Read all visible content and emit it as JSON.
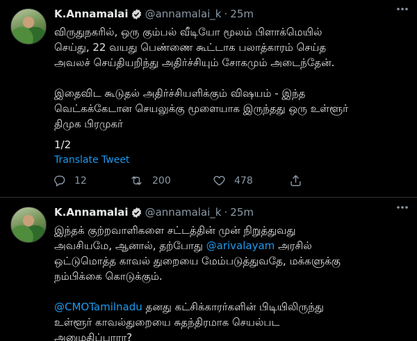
{
  "colors": {
    "background": "#000000",
    "text": "#e1e1e1",
    "secondary": "#8b98a5",
    "link": "#1d9bf0",
    "verified": "#d9d9d9"
  },
  "tweets": [
    {
      "name": "K.Annamalai",
      "handle": "@annamalai_k",
      "dot": "·",
      "time": "25m",
      "verified_icon": "verified-badge-icon",
      "lines": [
        "விருதுநகரில், ஒரு கும்பல் வீடியோ மூலம் பிளாக்மெயில்",
        "செய்து, 22 வயது பெண்ணை  கூட்டாக பலாத்காரம் செய்த",
        "அவலச் செய்தியறிந்து அதிர்ச்சியும் சோகமும் அடைந்தேன்.",
        "இதைவிட கூடுதல் அதிர்ச்சியளிக்கும் விஷயம் - இந்த",
        "வெட்கக்கேடான செயலுக்கு மூளையாக இருந்தது ஒரு உள்ளூர்",
        "திமுக பிரமுகர்"
      ],
      "thread_counter": "1/2",
      "translate_label": "Translate Tweet",
      "reply_count": "12",
      "retweet_count": "200",
      "like_count": "478"
    },
    {
      "name": "K.Annamalai",
      "handle": "@annamalai_k",
      "dot": "·",
      "time": "25m",
      "verified_icon": "verified-badge-icon",
      "line1": "இந்தக் குற்றவாளிகளை சட்டத்தின் முன் நிறுத்துவது",
      "line2_pre": "அவசியமே, ஆனால், தற்போது ",
      "line2_mention": "@arivalayam",
      "line2_post": " அரசில்",
      "line3": "ஒட்டுமொத்த காவல் துறையை மேம்படுத்துவதே, மக்களுக்கு",
      "line4": "நம்பிக்கை கொடுக்கும்.",
      "line5_mention": "@CMOTamilnadu",
      "line5_post": " தனது கட்சிக்காரர்களின் பிடியிலிருந்து",
      "line6": "உள்ளூர் காவல்துறையை சுதந்திரமாக செயல்பட",
      "line7": "அனுமதிப்பாரா?"
    }
  ]
}
